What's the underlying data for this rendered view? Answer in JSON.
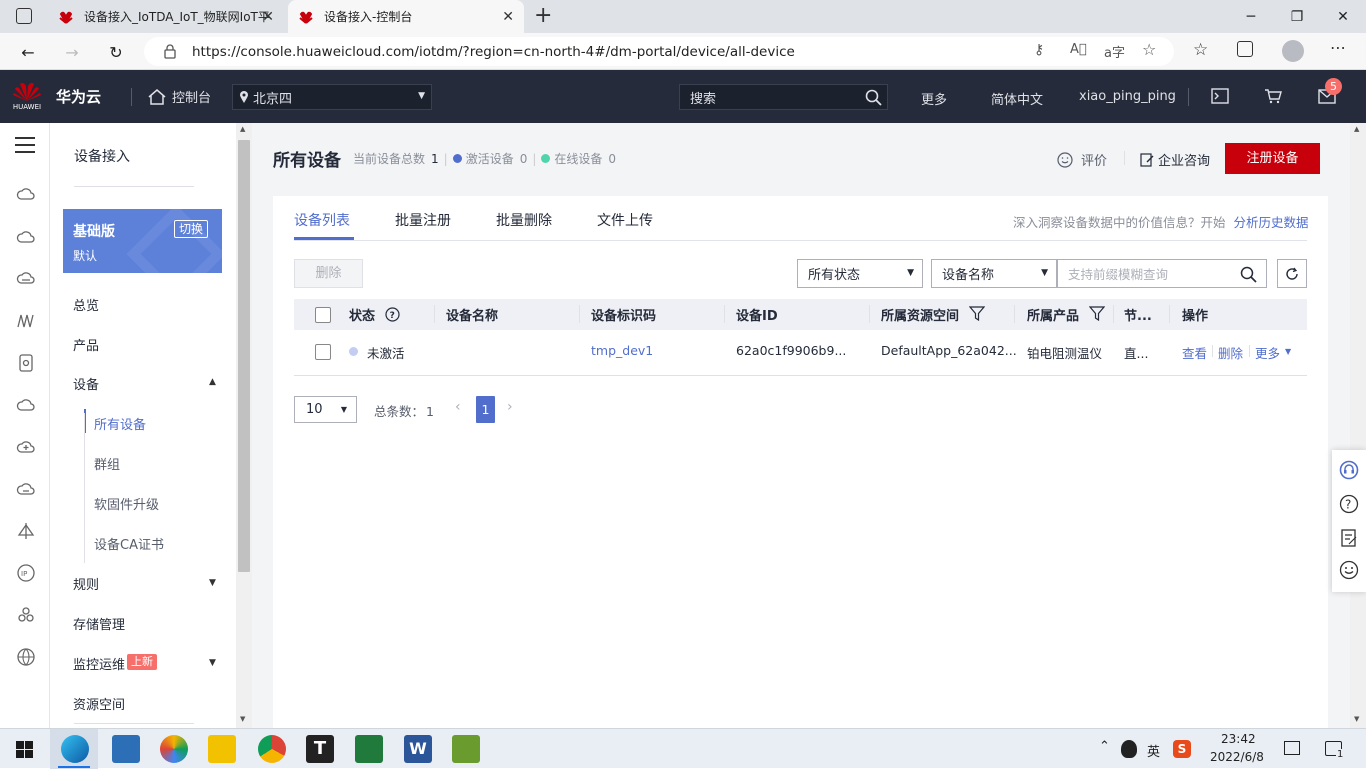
{
  "browser": {
    "tabs": [
      {
        "title": "设备接入_IoTDA_IoT_物联网IoT平"
      },
      {
        "title": "设备接入-控制台"
      }
    ],
    "url": "https://console.huaweicloud.com/iotdm/?region=cn-north-4#/dm-portal/device/all-device"
  },
  "header": {
    "brand_logo_text": "HUAWEI",
    "brand": "华为云",
    "console": "控制台",
    "region": "北京四",
    "search_placeholder": "搜索",
    "more": "更多",
    "language": "简体中文",
    "user": "xiao_ping_ping",
    "notification_count": "5"
  },
  "sidebar": {
    "title": "设备接入",
    "edition": {
      "name": "基础版",
      "switch": "切换",
      "sub": "默认"
    },
    "items": [
      {
        "label": "总览"
      },
      {
        "label": "产品"
      },
      {
        "label": "设备"
      },
      {
        "label": "所有设备"
      },
      {
        "label": "群组"
      },
      {
        "label": "软固件升级"
      },
      {
        "label": "设备CA证书"
      },
      {
        "label": "规则"
      },
      {
        "label": "存储管理"
      },
      {
        "label": "监控运维",
        "badge": "上新"
      },
      {
        "label": "资源空间"
      }
    ]
  },
  "page": {
    "title": "所有设备",
    "total_label": "当前设备总数",
    "total": "1",
    "active_label": "激活设备",
    "active": "0",
    "online_label": "在线设备",
    "online": "0",
    "rate": "评价",
    "consult": "企业咨询",
    "register": "注册设备",
    "tabs": [
      "设备列表",
      "批量注册",
      "批量删除",
      "文件上传"
    ],
    "insight_text": "深入洞察设备数据中的价值信息？开始",
    "insight_link": "分析历史数据",
    "delete_button": "删除",
    "status_filter": "所有状态",
    "field_filter": "设备名称",
    "search_placeholder": "支持前缀模糊查询",
    "columns": [
      "状态",
      "设备名称",
      "设备标识码",
      "设备ID",
      "所属资源空间",
      "所属产品",
      "节...",
      "操作"
    ],
    "rows": [
      {
        "status": "未激活",
        "name": "",
        "node_id": "tmp_dev1",
        "device_id": "62a0c1f9906b9...",
        "space": "DefaultApp_62a042...",
        "product": "铂电阻测温仪",
        "node_type": "直...",
        "actions": [
          "查看",
          "删除",
          "更多"
        ]
      }
    ],
    "page_size": "10",
    "total_items_label": "总条数：",
    "total_items": "1",
    "current_page": "1"
  },
  "taskbar": {
    "ime": "英",
    "time": "23:42",
    "date": "2022/6/8",
    "notify": "1"
  },
  "colors": {
    "header_bg": "#252b3a",
    "accent": "#526ecc",
    "register_red": "#c7000b",
    "badge_red": "#f66f6a",
    "status_inactive": "#c3cdf3",
    "active_dot": "#526ecc",
    "online_dot": "#50d4ab"
  }
}
